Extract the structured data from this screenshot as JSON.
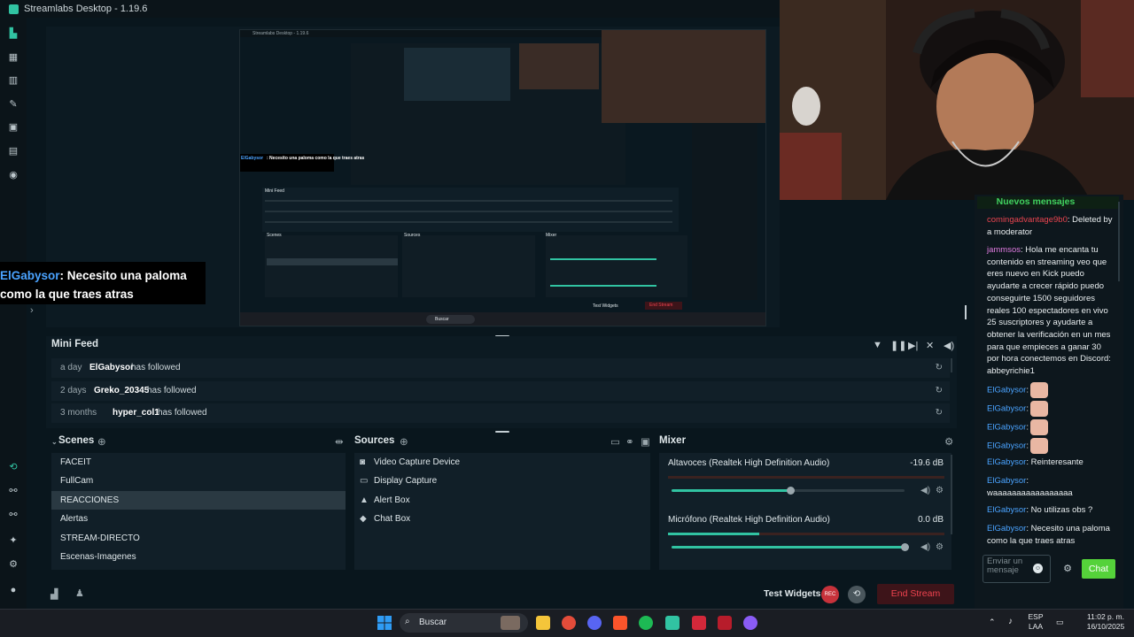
{
  "window": {
    "title": "Streamlabs Desktop - 1.19.6"
  },
  "overlay": {
    "user": "ElGabysor",
    "message_line1": ": Necesito una paloma",
    "message_line2": "como la que traes atras"
  },
  "chat": {
    "header": "Nuevos mensajes",
    "messages": [
      {
        "user": "comingadvantage9b0",
        "text": ": Deleted by a moderator",
        "user_color": "#e8444f"
      },
      {
        "user": "jammsos",
        "text": ": Hola me encanta tu contenido en streaming veo que eres nuevo en Kick puedo ayudarte a crecer rápido puedo conseguirte 1500 seguidores reales 100 espectadores en vivo 25 suscriptores y ayudarte a obtener la verificación en un mes para que empieces a ganar 30 por hora conectemos en Discord: abbeyrichie1",
        "user_color": "#e07be0"
      },
      {
        "user": "ElGabysor",
        "text": ":",
        "user_color": "#4aa3ff"
      },
      {
        "user": "ElGabysor",
        "text": ":",
        "user_color": "#4aa3ff"
      },
      {
        "user": "ElGabysor",
        "text": ":",
        "user_color": "#4aa3ff"
      },
      {
        "user": "ElGabysor",
        "text": ":",
        "user_color": "#4aa3ff"
      },
      {
        "user": "ElGabysor",
        "text": ": Reinteresante",
        "user_color": "#4aa3ff"
      },
      {
        "user": "ElGabysor",
        "text": ": waaaaaaaaaaaaaaaaa",
        "user_color": "#4aa3ff"
      },
      {
        "user": "ElGabysor",
        "text": ": No utilizas obs ?",
        "user_color": "#4aa3ff"
      },
      {
        "user": "ElGabysor",
        "text": ": Necesito una paloma como la que traes atras",
        "user_color": "#4aa3ff"
      }
    ],
    "input_placeholder": "Enviar un mensaje",
    "send_label": "Chat"
  },
  "minifeed": {
    "title": "Mini Feed",
    "rows": [
      {
        "age": "a day",
        "name": "ElGabysor",
        "action": "has followed"
      },
      {
        "age": "2 days",
        "name": "Greko_20345",
        "action": "has followed"
      },
      {
        "age": "3 months",
        "name": "hyper_col1",
        "action": "has followed"
      }
    ]
  },
  "scenes": {
    "title": "Scenes",
    "items": [
      "FACEIT",
      "FullCam",
      "REACCIONES",
      "Alertas",
      "STREAM-DIRECTO",
      "Escenas-Imagenes"
    ],
    "active_index": 2
  },
  "sources": {
    "title": "Sources",
    "items": [
      {
        "label": "Video Capture Device",
        "icon": "webcam-icon"
      },
      {
        "label": "Display Capture",
        "icon": "monitor-icon"
      },
      {
        "label": "Alert Box",
        "icon": "bell-icon"
      },
      {
        "label": "Chat Box",
        "icon": "chat-icon"
      }
    ]
  },
  "mixer": {
    "title": "Mixer",
    "channels": [
      {
        "name": "Altavoces (Realtek High Definition Audio)",
        "db": "-19.6 dB",
        "volume": 0.51,
        "meter": 0.0
      },
      {
        "name": "Micrófono (Realtek High Definition Audio)",
        "db": "0.0 dB",
        "volume": 1.0,
        "meter": 0.33
      }
    ]
  },
  "footer": {
    "test_widgets": "Test Widgets",
    "rec": "REC",
    "end_stream": "End Stream"
  },
  "taskbar": {
    "search": "Buscar",
    "lang_line1": "ESP",
    "lang_line2": "LAA",
    "time": "11:02 p. m.",
    "date": "16/10/2025"
  },
  "inner_preview": {
    "title": "Streamlabs Desktop - 1.19.6",
    "overlay_user": "ElGabysor",
    "overlay_msg": ": Necesito una paloma como la que traes atras",
    "minifeed_title": "Mini Feed",
    "scenes_title": "Scenes",
    "sources_title": "Sources",
    "mixer_title": "Mixer",
    "test_widgets": "Test Widgets",
    "end_stream": "End Stream",
    "search": "Buscar"
  }
}
